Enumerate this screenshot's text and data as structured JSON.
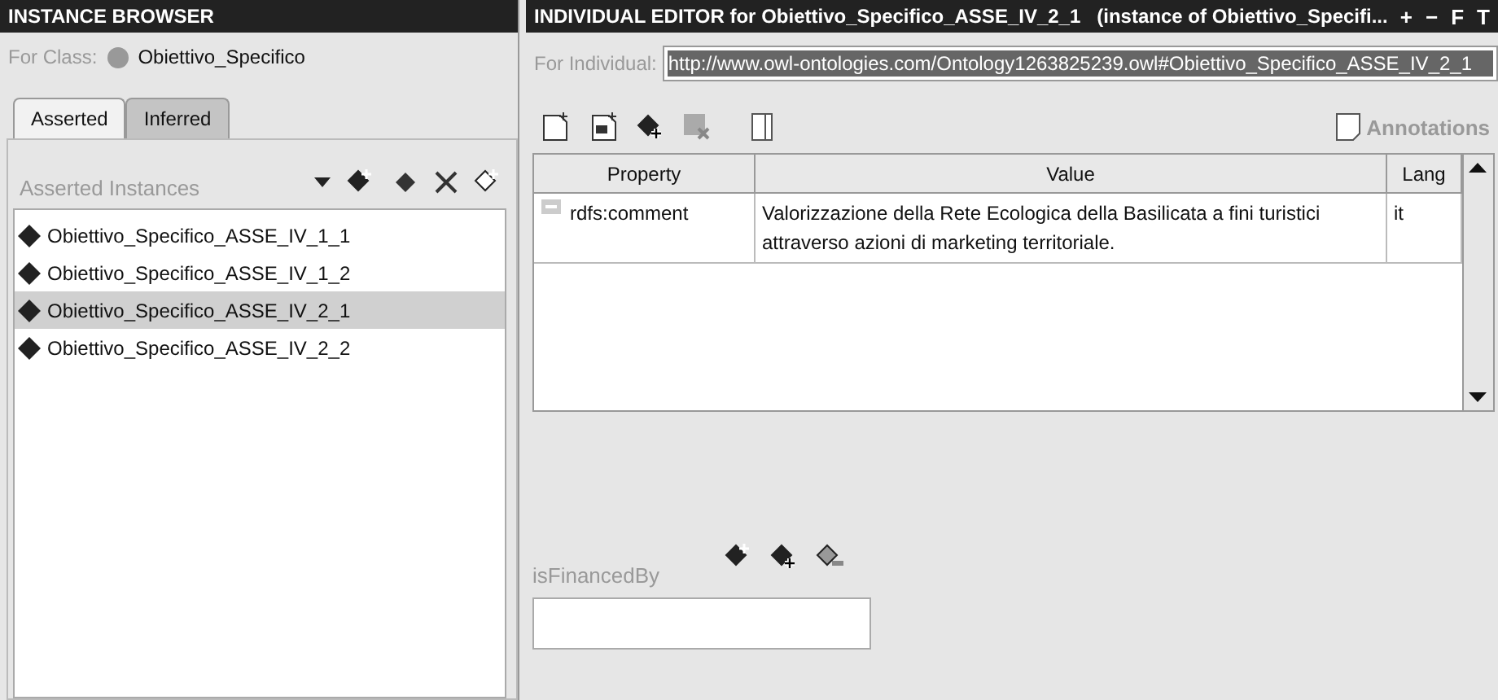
{
  "instance_browser": {
    "title": "INSTANCE BROWSER",
    "class_label": "For Class:",
    "class_name": "Obiettivo_Specifico",
    "tabs": [
      {
        "label": "Asserted",
        "selected": true
      },
      {
        "label": "Inferred",
        "selected": false
      }
    ],
    "list_title": "Asserted Instances",
    "instances": [
      {
        "name": "Obiettivo_Specifico_ASSE_IV_1_1",
        "selected": false
      },
      {
        "name": "Obiettivo_Specifico_ASSE_IV_1_2",
        "selected": false
      },
      {
        "name": "Obiettivo_Specifico_ASSE_IV_2_1",
        "selected": true
      },
      {
        "name": "Obiettivo_Specifico_ASSE_IV_2_2",
        "selected": false
      }
    ]
  },
  "individual_editor": {
    "title": "INDIVIDUAL EDITOR for Obiettivo_Specifico_ASSE_IV_2_1   (instance of Obiettivo_Specifi...",
    "header_buttons": [
      "+",
      "−",
      "F",
      "T"
    ],
    "individual_label": "For Individual:",
    "individual_uri": "http://www.owl-ontologies.com/Ontology1263825239.owl#Obiettivo_Specifico_ASSE_IV_2_1",
    "annotations_label": "Annotations",
    "table": {
      "columns": [
        "Property",
        "Value",
        "Lang"
      ],
      "rows": [
        {
          "property": "rdfs:comment",
          "value": "Valorizzazione della Rete Ecologica della Basilicata a fini turistici attraverso azioni di marketing territoriale.",
          "lang": "it"
        }
      ]
    },
    "slot": {
      "label": "isFinancedBy"
    }
  }
}
